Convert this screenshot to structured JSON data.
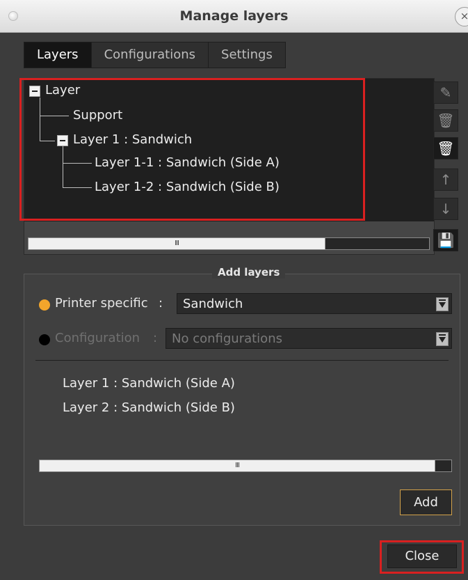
{
  "window": {
    "title": "Manage layers",
    "close_glyph": "×"
  },
  "tabs": [
    {
      "label": "Layers",
      "active": true
    },
    {
      "label": "Configurations",
      "active": false
    },
    {
      "label": "Settings",
      "active": false
    }
  ],
  "tree": {
    "root": "Layer",
    "children": [
      {
        "label": "Support"
      },
      {
        "label": "Layer 1 : Sandwich",
        "children": [
          {
            "label": "Layer 1-1 : Sandwich (Side A)"
          },
          {
            "label": "Layer 1-2 : Sandwich (Side B)"
          }
        ]
      }
    ],
    "scroll_fraction": 0.74
  },
  "side_tools": [
    {
      "name": "edit-icon",
      "glyph": "✎"
    },
    {
      "name": "trash-icon",
      "glyph": "🗑"
    },
    {
      "name": "trash-list-icon",
      "glyph": "🗑"
    },
    {
      "name": "arrow-up-icon",
      "glyph": "↑"
    },
    {
      "name": "arrow-down-icon",
      "glyph": "↓"
    },
    {
      "name": "save-icon",
      "glyph": "💾"
    }
  ],
  "add_layers": {
    "legend": "Add layers",
    "printer_specific": {
      "label": "Printer specific",
      "separator": ":",
      "value": "Sandwich",
      "selected": true
    },
    "configuration": {
      "label": "Configuration",
      "separator": ":",
      "value": "No configurations",
      "selected": false
    },
    "results": [
      "Layer 1 : Sandwich (Side A)",
      "Layer 2 : Sandwich (Side B)"
    ],
    "scroll_fraction": 0.96,
    "add_label": "Add"
  },
  "close_label": "Close",
  "colors": {
    "highlight": "#d92020",
    "accent": "#f2a52b"
  }
}
